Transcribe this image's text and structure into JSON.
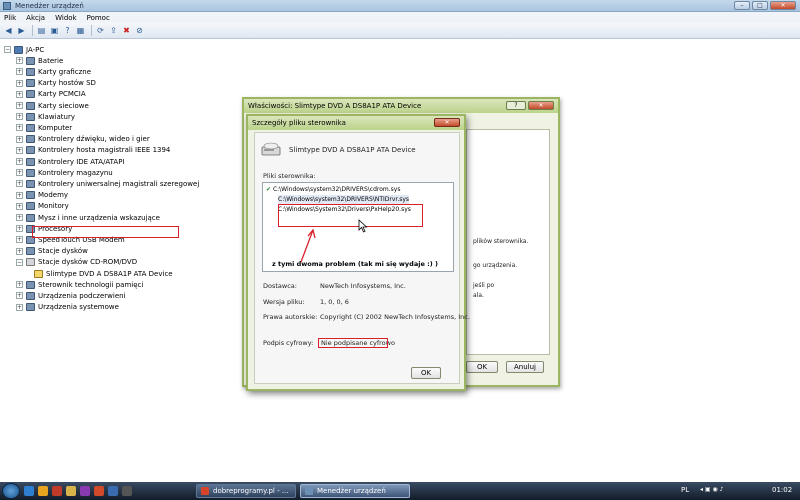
{
  "window": {
    "title": "Menedżer urządzeń",
    "controls": {
      "minimize": "–",
      "maximize": "□",
      "close": "✕"
    }
  },
  "menu": [
    "Plik",
    "Akcja",
    "Widok",
    "Pomoc"
  ],
  "toolbar_icons": [
    "back-arrow-icon",
    "forward-arrow-icon",
    "tree-view-icon",
    "properties-icon",
    "help-icon",
    "drivers-icon",
    "scan-hardware-icon",
    "update-driver-icon",
    "uninstall-icon",
    "disable-icon"
  ],
  "tree": {
    "root": "JA-PC",
    "items": [
      "Baterie",
      "Karty graficzne",
      "Karty hostów SD",
      "Karty PCMCIA",
      "Karty sieciowe",
      "Klawiatury",
      "Komputer",
      "Kontrolery dźwięku, wideo i gier",
      "Kontrolery hosta magistrali IEEE 1394",
      "Kontrolery IDE ATA/ATAPI",
      "Kontrolery magazynu",
      "Kontrolery uniwersalnej magistrali szeregowej",
      "Modemy",
      "Monitory",
      "Mysz i inne urządzenia wskazujące",
      "Procesory",
      "SpeedTouch USB Modem",
      "Stacje dysków",
      "Stacje dysków CD-ROM/DVD",
      "Slimtype DVD A  DS8A1P ATA Device",
      "Sterownik technologii pamięci",
      "Urządzenia podczerwieni",
      "Urządzenia systemowe"
    ]
  },
  "properties_dialog": {
    "title": "Właściwości: Slimtype DVD A  DS8A1P ATA Device",
    "help_label": "?",
    "close_label": "✕",
    "fragments": [
      "plików sterownika.",
      "go urządzenia.",
      "jeśli po",
      "ala."
    ],
    "ok_label": "OK",
    "cancel_label": "Anuluj"
  },
  "details_dialog": {
    "title": "Szczegóły pliku sterownika",
    "close_label": "✕",
    "device_name": "Slimtype DVD A  DS8A1P ATA Device",
    "files_label": "Pliki sterownika:",
    "files": [
      "C:\\Windows\\system32\\DRIVERS\\cdrom.sys",
      "C:\\Windows\\system32\\DRIVERS\\NTIDrvr.sys",
      "C:\\Windows\\System32\\Drivers\\PxHelp20.sys"
    ],
    "annotation": "z tymi dwoma problem (tak mi się wydaje :) )",
    "provider_label": "Dostawca:",
    "provider_value": "NewTech Infosystems, Inc.",
    "version_label": "Wersja pliku:",
    "version_value": "1, 0, 0, 6",
    "copyright_label": "Prawa autorskie:",
    "copyright_value": "Copyright (C) 2002 NewTech Infosystems, Inc.",
    "signature_label": "Podpis cyfrowy:",
    "signature_value": "Nie podpisane cyfrowo",
    "ok_label": "OK"
  },
  "taskbar": {
    "tasks": [
      "dobreprogramy.pl - ...",
      "Menedżer urządzeń"
    ],
    "language": "PL",
    "clock": "01:02"
  },
  "colors": {
    "annotation_red": "#d8202a",
    "dialog_border": "#9bb561",
    "taskbar": "#1e2a3a"
  }
}
